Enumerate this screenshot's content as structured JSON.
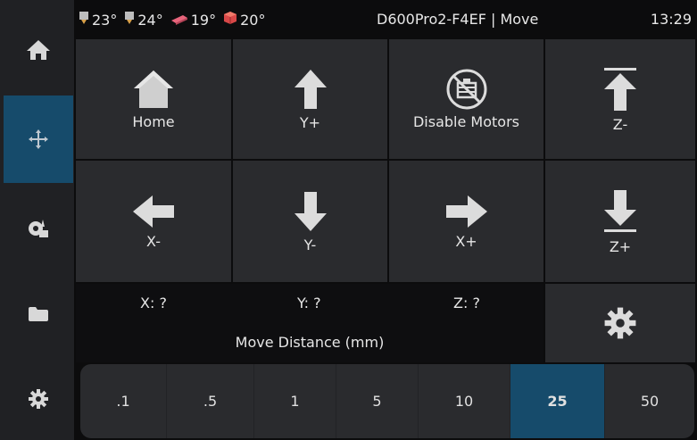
{
  "header": {
    "temperatures": [
      {
        "icon": "extruder-icon",
        "value": "23°"
      },
      {
        "icon": "extruder-icon",
        "value": "24°"
      },
      {
        "icon": "heated-bed-icon",
        "value": "19°"
      },
      {
        "icon": "chamber-icon",
        "value": "20°"
      }
    ],
    "title": "D600Pro2-F4EF | Move",
    "time": "13:29"
  },
  "sidebar": {
    "items": [
      {
        "icon": "home-icon",
        "active": false
      },
      {
        "icon": "move-icon",
        "active": true
      },
      {
        "icon": "extrude-icon",
        "active": false
      },
      {
        "icon": "folder-icon",
        "active": false
      },
      {
        "icon": "gear-icon",
        "active": false
      }
    ]
  },
  "controls": {
    "home": "Home",
    "y_plus": "Y+",
    "disable_motors": "Disable Motors",
    "z_minus": "Z-",
    "x_minus": "X-",
    "y_minus": "Y-",
    "x_plus": "X+",
    "z_plus": "Z+"
  },
  "position": {
    "x": "X: ?",
    "y": "Y: ?",
    "z": "Z: ?",
    "move_distance_label": "Move Distance (mm)"
  },
  "distances": {
    "options": [
      ".1",
      ".5",
      "1",
      "5",
      "10",
      "25",
      "50"
    ],
    "selected": "25"
  },
  "colors": {
    "accent": "#164b6b",
    "button_bg": "#2a2b2e",
    "sidebar_bg": "#202124"
  }
}
